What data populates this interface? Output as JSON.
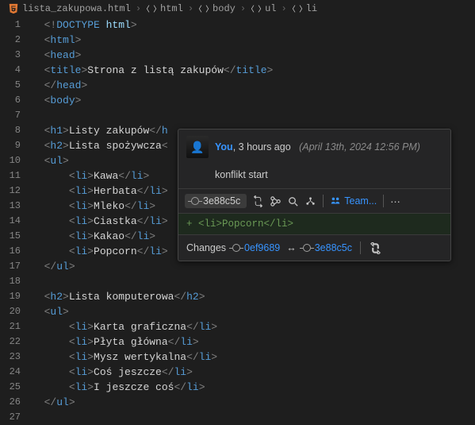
{
  "breadcrumbs": {
    "file": "lista_zakupowa.html",
    "items": [
      "html",
      "body",
      "ul",
      "li"
    ]
  },
  "code": {
    "l1_a": "<!",
    "l1_b": "DOCTYPE",
    "l1_c": " html",
    "l1_d": ">",
    "l2": "html",
    "l3": "head",
    "l4_open": "title",
    "l4_txt": "Strona z listą zakupów",
    "l4_close": "title",
    "l5": "head",
    "l6": "body",
    "l8_open": "h1",
    "l8_txt": "Listy zakupów",
    "l8_close": "h",
    "l9_open": "h2",
    "l9_txt": "Lista spożywcza",
    "l9_close_frag": "",
    "l10": "ul",
    "li11": "Kawa",
    "li12": "Herbata",
    "li13": "Mleko",
    "li14": "Ciastka",
    "li15": "Kakao",
    "li16": "Popcorn",
    "l17": "ul",
    "l19_open": "h2",
    "l19_txt": "Lista komputerowa",
    "l19_close": "h2",
    "l20": "ul",
    "li21": "Karta graficzna",
    "li22": "Płyta główna",
    "li23": "Mysz wertykalna",
    "li24": "Coś jeszcze",
    "li25": "I jeszcze coś",
    "l26": "ul",
    "li_tag": "li"
  },
  "codelens": {
    "text": "You, 3 hours ago • konflikt start"
  },
  "hover": {
    "author": "You",
    "comma": ", ",
    "timeago": "3 hours ago",
    "date": "(April 13th, 2024 12:56 PM)",
    "message": "konflikt start",
    "commit_short": "3e88c5c",
    "diff_line": "+ <li>Popcorn</li>",
    "changes_label": "Changes",
    "from_commit": "0ef9689",
    "to_commit": "3e88c5c",
    "team_label": "Team..."
  },
  "lineno": {
    "n1": "1",
    "n2": "2",
    "n3": "3",
    "n4": "4",
    "n5": "5",
    "n6": "6",
    "n7": "7",
    "n8": "8",
    "n9": "9",
    "n10": "10",
    "n11": "11",
    "n12": "12",
    "n13": "13",
    "n14": "14",
    "n15": "15",
    "n16": "16",
    "n17": "17",
    "n18": "18",
    "n19": "19",
    "n20": "20",
    "n21": "21",
    "n22": "22",
    "n23": "23",
    "n24": "24",
    "n25": "25",
    "n26": "26",
    "n27": "27"
  }
}
